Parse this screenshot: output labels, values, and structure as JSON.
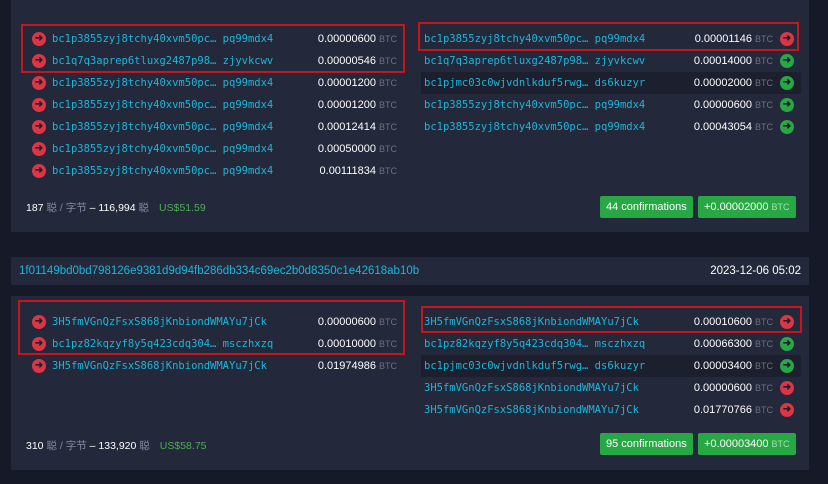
{
  "tx1": {
    "inputs": [
      {
        "addr": "bc1p3855zyj8tchy40xvm50pc… pq99mdx4",
        "amount": "0.00000600",
        "unit": "BTC",
        "dir": "red"
      },
      {
        "addr": "bc1q7q3aprep6tluxg2487p98… zjyvkcwv",
        "amount": "0.00000546",
        "unit": "BTC",
        "dir": "red"
      },
      {
        "addr": "bc1p3855zyj8tchy40xvm50pc… pq99mdx4",
        "amount": "0.00001200",
        "unit": "BTC",
        "dir": "red"
      },
      {
        "addr": "bc1p3855zyj8tchy40xvm50pc… pq99mdx4",
        "amount": "0.00001200",
        "unit": "BTC",
        "dir": "red"
      },
      {
        "addr": "bc1p3855zyj8tchy40xvm50pc… pq99mdx4",
        "amount": "0.00012414",
        "unit": "BTC",
        "dir": "red"
      },
      {
        "addr": "bc1p3855zyj8tchy40xvm50pc… pq99mdx4",
        "amount": "0.00050000",
        "unit": "BTC",
        "dir": "red"
      },
      {
        "addr": "bc1p3855zyj8tchy40xvm50pc… pq99mdx4",
        "amount": "0.00111834",
        "unit": "BTC",
        "dir": "red"
      }
    ],
    "outputs": [
      {
        "addr": "bc1p3855zyj8tchy40xvm50pc… pq99mdx4",
        "amount": "0.00001146",
        "unit": "BTC",
        "dir": "red"
      },
      {
        "addr": "bc1q7q3aprep6tluxg2487p98… zjyvkcwv",
        "amount": "0.00014000",
        "unit": "BTC",
        "dir": "green"
      },
      {
        "addr": "bc1pjmc03c0wjvdnlkduf5rwg… ds6kuzyr",
        "amount": "0.00002000",
        "unit": "BTC",
        "dir": "green",
        "highlight": true
      },
      {
        "addr": "bc1p3855zyj8tchy40xvm50pc… pq99mdx4",
        "amount": "0.00000600",
        "unit": "BTC",
        "dir": "green"
      },
      {
        "addr": "bc1p3855zyj8tchy40xvm50pc… pq99mdx4",
        "amount": "0.00043054",
        "unit": "BTC",
        "dir": "green"
      }
    ],
    "fee_rate": "187",
    "fee_rate_unit": "聪 / 字节",
    "dash": "–",
    "fee": "116,994",
    "fee_unit": "聪",
    "usd": "US$51.59",
    "confirmations": "44 confirmations",
    "net": "+0.00002000",
    "net_unit": "BTC"
  },
  "tx2": {
    "txid": "1f01149bd0bd798126e9381d9d94fb286db334c69ec2b0d8350c1e42618ab10b",
    "time": "2023-12-06 05:02",
    "inputs": [
      {
        "addr": "3H5fmVGnQzFsxS868jKnbiondWMAYu7jCk",
        "amount": "0.00000600",
        "unit": "BTC",
        "dir": "red"
      },
      {
        "addr": "bc1pz82kqzyf8y5q423cdq304… msczhxzq",
        "amount": "0.00010000",
        "unit": "BTC",
        "dir": "red"
      },
      {
        "addr": "3H5fmVGnQzFsxS868jKnbiondWMAYu7jCk",
        "amount": "0.01974986",
        "unit": "BTC",
        "dir": "red"
      }
    ],
    "outputs": [
      {
        "addr": "3H5fmVGnQzFsxS868jKnbiondWMAYu7jCk",
        "amount": "0.00010600",
        "unit": "BTC",
        "dir": "red"
      },
      {
        "addr": "bc1pz82kqzyf8y5q423cdq304… msczhxzq",
        "amount": "0.00066300",
        "unit": "BTC",
        "dir": "green"
      },
      {
        "addr": "bc1pjmc03c0wjvdnlkduf5rwg… ds6kuzyr",
        "amount": "0.00003400",
        "unit": "BTC",
        "dir": "green",
        "highlight": true
      },
      {
        "addr": "3H5fmVGnQzFsxS868jKnbiondWMAYu7jCk",
        "amount": "0.00000600",
        "unit": "BTC",
        "dir": "red"
      },
      {
        "addr": "3H5fmVGnQzFsxS868jKnbiondWMAYu7jCk",
        "amount": "0.01770766",
        "unit": "BTC",
        "dir": "red"
      }
    ],
    "fee_rate": "310",
    "fee_rate_unit": "聪 / 字节",
    "dash": "–",
    "fee": "133,920",
    "fee_unit": "聪",
    "usd": "US$58.75",
    "confirmations": "95 confirmations",
    "net": "+0.00003400",
    "net_unit": "BTC"
  }
}
